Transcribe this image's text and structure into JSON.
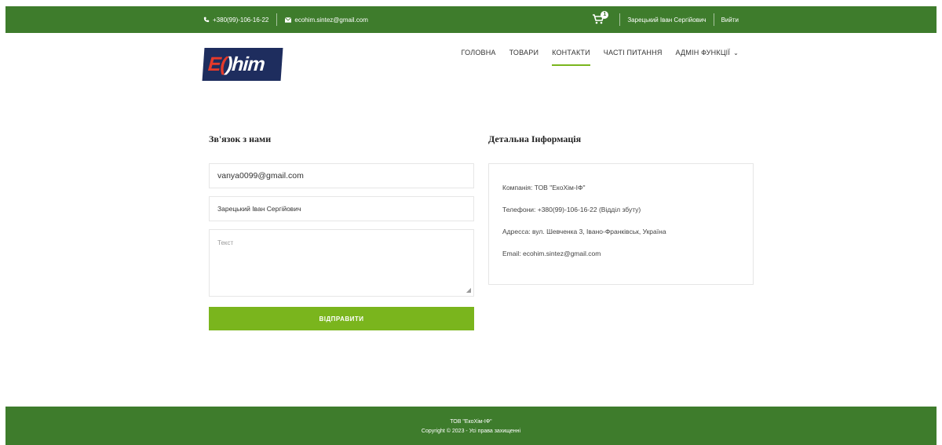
{
  "topbar": {
    "phone": "+380(99)-106-16-22",
    "email": "ecohim.sintez@gmail.com",
    "cart_count": "1",
    "user_name": "Зарецький Іван Сергійович",
    "logout_label": "Вийти"
  },
  "header": {
    "logo_prefix": "E(",
    "logo_suffix": ")him",
    "nav": [
      {
        "label": "ГОЛОВНА"
      },
      {
        "label": "ТОВАРИ"
      },
      {
        "label": "КОНТАКТИ"
      },
      {
        "label": "ЧАСТІ ПИТАННЯ"
      },
      {
        "label": "АДМІН ФУНКЦІЇ"
      }
    ],
    "active_nav": "КОНТАКТИ"
  },
  "contact_form": {
    "title": "Зв'язок з нами",
    "email_value": "vanya0099@gmail.com",
    "name_value": "Зарецький Іван Сергійович",
    "message_placeholder": "Текст",
    "submit_label": "ВІДПРАВИТИ"
  },
  "details": {
    "title": "Детальна Інформація",
    "company": "Компанія: ТОВ \"ЕкоХім-ІФ\"",
    "phones": "Телефони: +380(99)-106-16-22 (Відділ збуту)",
    "address": "Адресса: вул. Шевченка 3, Івано-Франківськ, Україна",
    "email": "Email: ecohim.sintez@gmail.com"
  },
  "footer": {
    "company": "ТОВ \"ЕкоХім-ІФ\"",
    "copyright": "Copyright © 2023 - Усі права захищенні"
  },
  "colors": {
    "brand_green": "#3e7c2c",
    "accent_green": "#7ab51d",
    "logo_navy": "#1e2d5e",
    "logo_red": "#e53a2a"
  }
}
